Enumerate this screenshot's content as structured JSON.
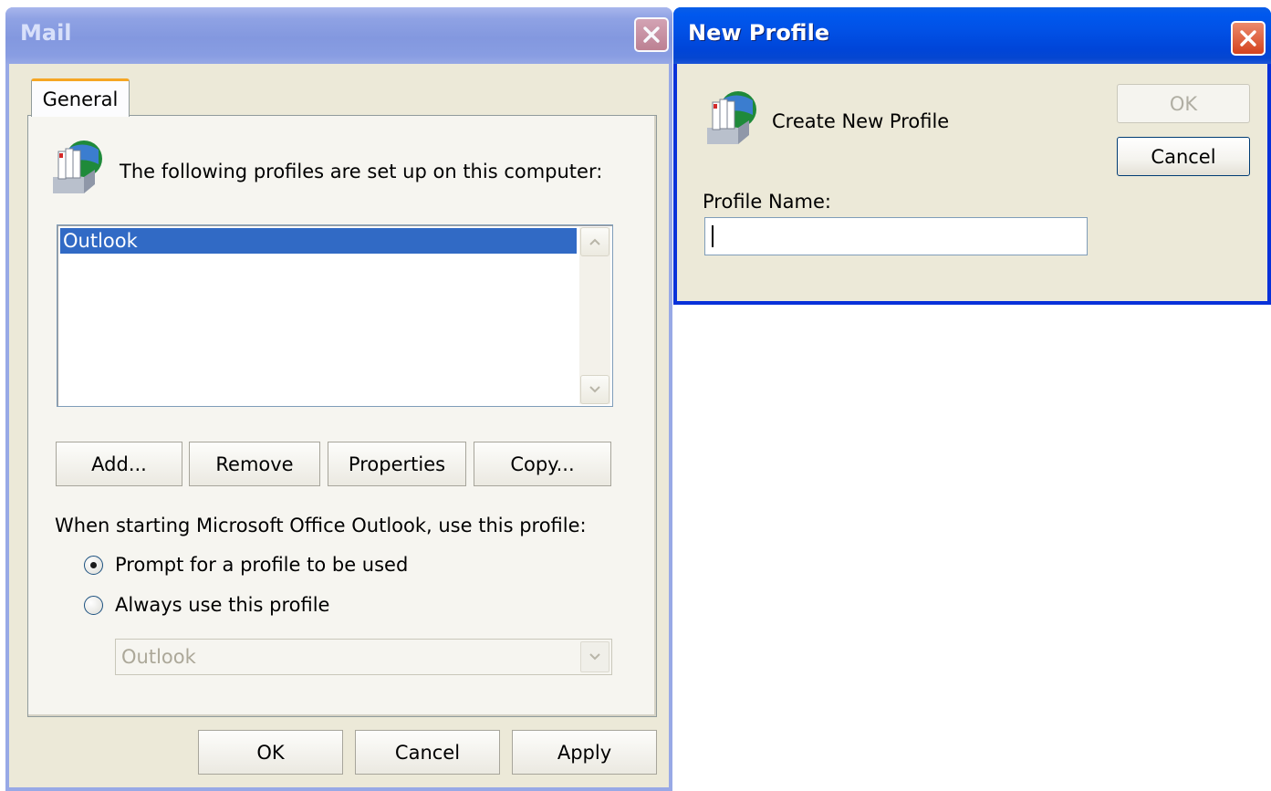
{
  "mail": {
    "title": "Mail",
    "tab_general": "General",
    "intro": "The following profiles are set up on this computer:",
    "profiles": [
      "Outlook"
    ],
    "buttons": {
      "add": "Add...",
      "remove": "Remove",
      "properties": "Properties",
      "copy": "Copy..."
    },
    "startup_label": "When starting Microsoft Office Outlook, use this profile:",
    "radio_prompt": "Prompt for a profile to be used",
    "radio_always": "Always use this profile",
    "radio_selected": "prompt",
    "profile_combo_value": "Outlook",
    "footer": {
      "ok": "OK",
      "cancel": "Cancel",
      "apply": "Apply"
    }
  },
  "new_profile": {
    "title": "New Profile",
    "heading": "Create New Profile",
    "name_label": "Profile Name:",
    "name_value": "",
    "ok": "OK",
    "cancel": "Cancel"
  },
  "icons": {
    "close": "close-icon",
    "profiles": "mail-profiles-icon",
    "scroll_up": "scroll-up-arrow-icon",
    "scroll_down": "scroll-down-arrow-icon",
    "dropdown": "chevron-down-icon"
  },
  "colors": {
    "active_title": "#0151e6",
    "inactive_title": "#8398df",
    "selection": "#316ac5",
    "dialog_bg": "#ece9d8"
  }
}
